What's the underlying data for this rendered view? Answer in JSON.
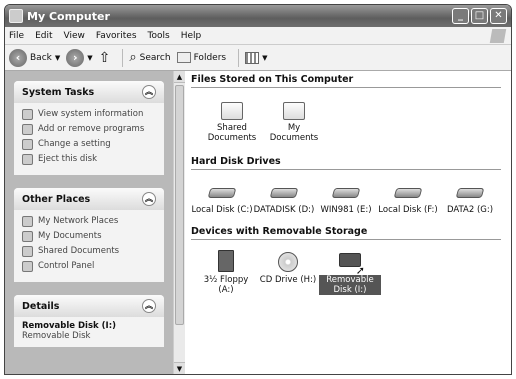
{
  "window": {
    "title": "My Computer"
  },
  "menu": [
    "File",
    "Edit",
    "View",
    "Favorites",
    "Tools",
    "Help"
  ],
  "toolbar": {
    "back": "Back",
    "search": "Search",
    "folders": "Folders"
  },
  "system_tasks": {
    "title": "System Tasks",
    "items": [
      {
        "label": "View system information",
        "icon": "info-icon"
      },
      {
        "label": "Add or remove programs",
        "icon": "programs-icon"
      },
      {
        "label": "Change a setting",
        "icon": "control-icon"
      },
      {
        "label": "Eject this disk",
        "icon": "eject-icon"
      }
    ]
  },
  "other_places": {
    "title": "Other Places",
    "items": [
      {
        "label": "My Network Places",
        "icon": "network-icon"
      },
      {
        "label": "My Documents",
        "icon": "folder-icon"
      },
      {
        "label": "Shared Documents",
        "icon": "folder-icon"
      },
      {
        "label": "Control Panel",
        "icon": "control-icon"
      }
    ]
  },
  "details": {
    "title": "Details",
    "name": "Removable Disk (I:)",
    "type": "Removable Disk"
  },
  "groups": [
    {
      "title": "Files Stored on This Computer",
      "items": [
        {
          "label": "Shared Documents",
          "kind": "folder"
        },
        {
          "label": "My Documents",
          "kind": "folder"
        }
      ]
    },
    {
      "title": "Hard Disk Drives",
      "items": [
        {
          "label": "Local Disk (C:)",
          "kind": "drive"
        },
        {
          "label": "DATADISK (D:)",
          "kind": "drive"
        },
        {
          "label": "WIN981 (E:)",
          "kind": "drive"
        },
        {
          "label": "Local Disk (F:)",
          "kind": "drive"
        },
        {
          "label": "DATA2 (G:)",
          "kind": "drive"
        }
      ]
    },
    {
      "title": "Devices with Removable Storage",
      "items": [
        {
          "label": "3½ Floppy (A:)",
          "kind": "floppy"
        },
        {
          "label": "CD Drive (H:)",
          "kind": "cd"
        },
        {
          "label": "Removable Disk (I:)",
          "kind": "usb",
          "selected": true
        }
      ]
    }
  ]
}
